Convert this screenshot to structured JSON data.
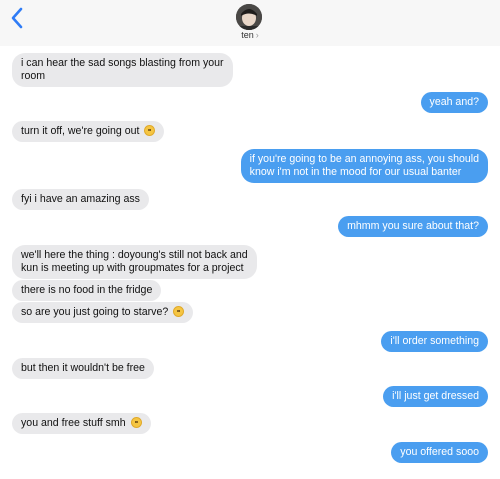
{
  "header": {
    "contact_name": "ten",
    "chevron": "›",
    "back_icon": "chevron-left-icon",
    "accent": "#4a9ef0"
  },
  "messages": [
    {
      "dir": "in",
      "lines": [
        "i can hear the sad songs blasting from your",
        "room"
      ]
    },
    {
      "dir": "out",
      "text": "yeah and?"
    },
    {
      "dir": "in",
      "text": "turn it off, we're going out",
      "emoji": "pleading-face-icon"
    },
    {
      "dir": "out",
      "lines": [
        "if you're going to be an annoying ass, you should",
        "know i'm not in the mood for our usual banter"
      ]
    },
    {
      "dir": "in",
      "text": "fyi i have an amazing ass"
    },
    {
      "dir": "out",
      "text": "mhmm you sure about that?"
    },
    {
      "dir": "in",
      "lines": [
        "we'll here the thing : doyoung's still not back and",
        "kun is meeting up with groupmates for a project"
      ]
    },
    {
      "dir": "in",
      "text": "there is no food in the fridge"
    },
    {
      "dir": "in",
      "text": "so are you just going to starve?",
      "emoji": "slightly-smiling-face-icon"
    },
    {
      "dir": "out",
      "text": "i'll order something"
    },
    {
      "dir": "in",
      "text": "but then it wouldn't be free"
    },
    {
      "dir": "out",
      "text": "i'll just get dressed"
    },
    {
      "dir": "in",
      "text": "you and free stuff smh",
      "emoji": "smiling-face-icon"
    },
    {
      "dir": "out",
      "text": "you offered sooo"
    }
  ],
  "colors": {
    "incoming": "#e9e9eb",
    "outgoing": "#4a9ef0"
  }
}
